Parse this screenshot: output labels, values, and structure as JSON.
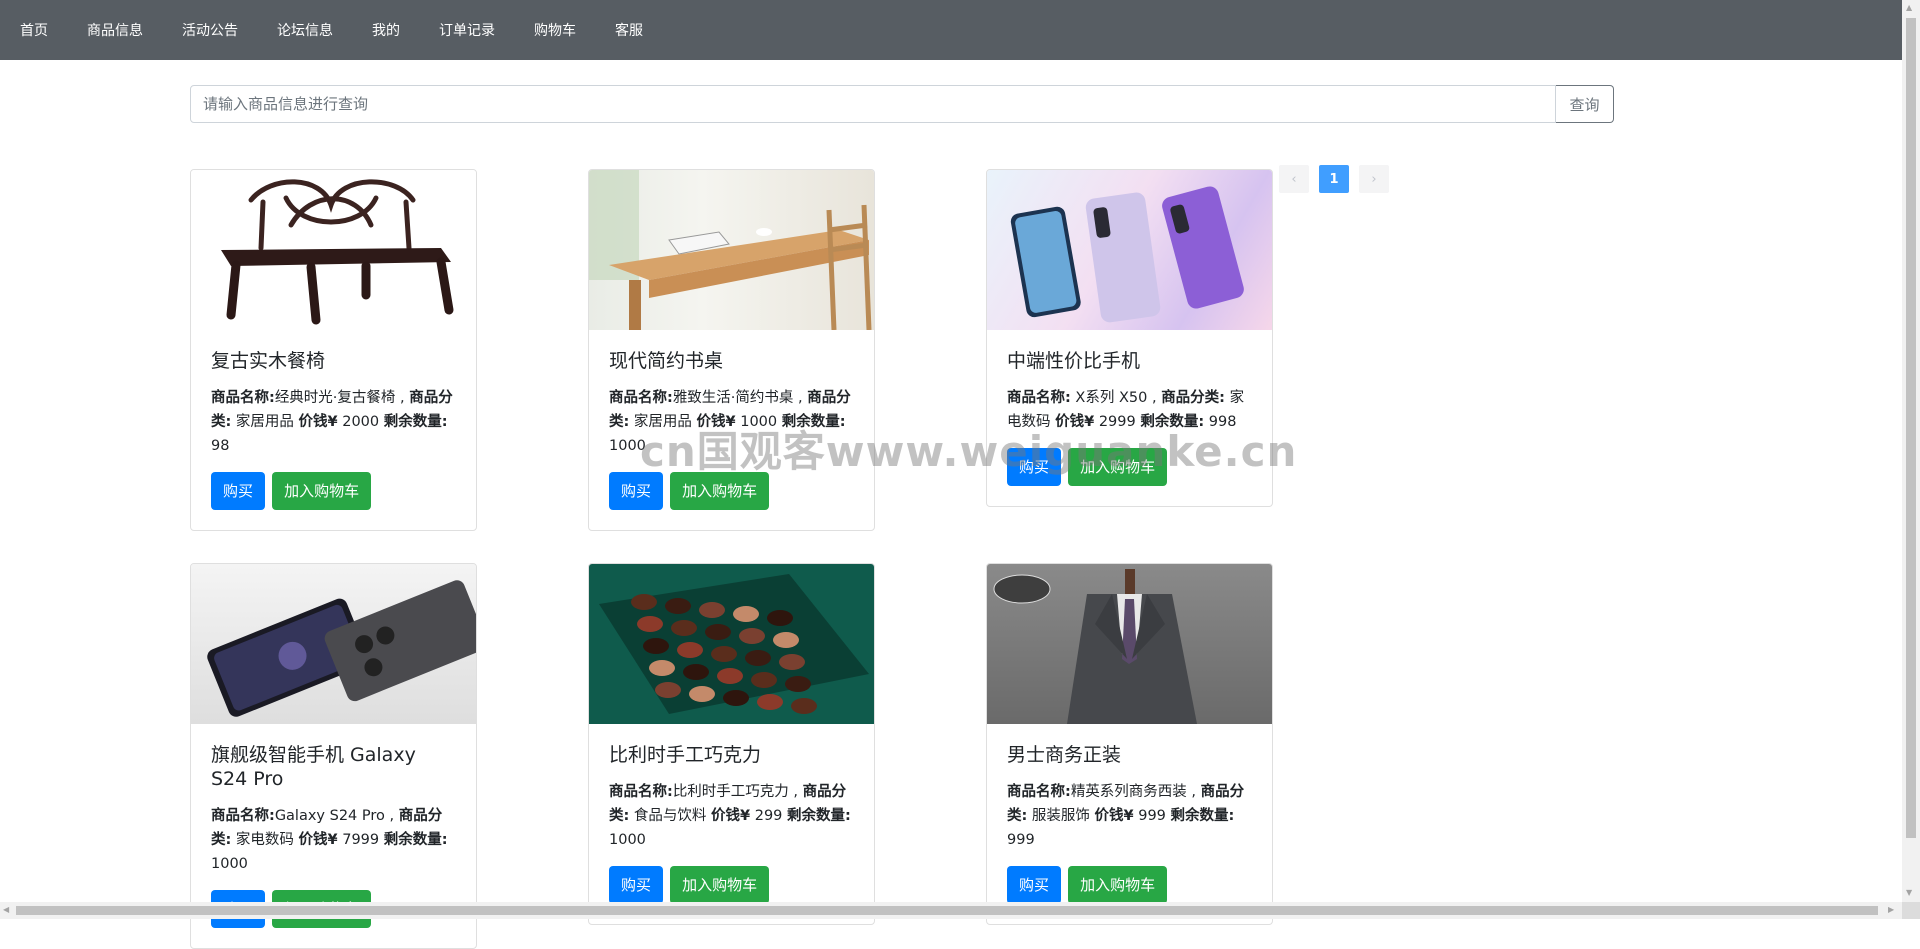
{
  "navbar": {
    "items": [
      "首页",
      "商品信息",
      "活动公告",
      "论坛信息",
      "我的",
      "订单记录",
      "购物车",
      "客服"
    ]
  },
  "search": {
    "placeholder": "请输入商品信息进行查询",
    "button": "查询"
  },
  "pagination": {
    "prev": "‹",
    "current": "1",
    "next": "›"
  },
  "labels": {
    "name": "商品名称:",
    "category": "商品分类:",
    "price": "价钱¥",
    "stock": "剩余数量:",
    "buy": "购买",
    "add_cart": "加入购物车"
  },
  "products": [
    {
      "title": "复古实木餐椅",
      "name": "经典时光·复古餐椅",
      "category": "家居用品",
      "price": "2000",
      "stock": "98"
    },
    {
      "title": "现代简约书桌",
      "name": "雅致生活·简约书桌",
      "category": "家居用品",
      "price": "1000",
      "stock": "1000"
    },
    {
      "title": "中端性价比手机",
      "name": "X系列 X50",
      "category": "家电数码",
      "price": "2999",
      "stock": "998"
    },
    {
      "title": "旗舰级智能手机 Galaxy S24 Pro",
      "name": "Galaxy S24 Pro",
      "category": "家电数码",
      "price": "7999",
      "stock": "1000"
    },
    {
      "title": "比利时手工巧克力",
      "name": "比利时手工巧克力",
      "category": "食品与饮料",
      "price": "299",
      "stock": "1000"
    },
    {
      "title": "男士商务正装",
      "name": "精英系列商务西装",
      "category": "服装服饰",
      "price": "999",
      "stock": "999"
    }
  ],
  "watermark": "cn国观客www.weiguanke.cn",
  "colors": {
    "navbar": "#575d63",
    "buy": "#007bff",
    "cart": "#28a745",
    "page_active": "#409eff"
  }
}
